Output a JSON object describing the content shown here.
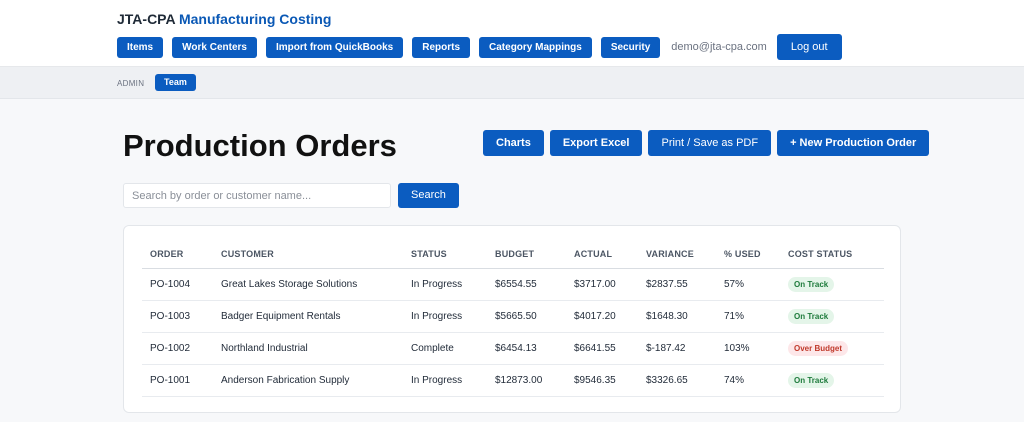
{
  "header": {
    "brand_prefix": "JTA-CPA",
    "brand_suffix": "Manufacturing Costing",
    "nav": [
      {
        "label": "Items"
      },
      {
        "label": "Work Centers"
      },
      {
        "label": "Import from QuickBooks"
      },
      {
        "label": "Reports"
      },
      {
        "label": "Category Mappings"
      },
      {
        "label": "Security"
      }
    ],
    "email": "demo@jta-cpa.com",
    "logout_label": "Log out"
  },
  "subnav": {
    "admin_label": "ADMIN",
    "team_label": "Team"
  },
  "main": {
    "title": "Production Orders",
    "actions": {
      "charts": "Charts",
      "export_excel": "Export Excel",
      "print_pdf": "Print / Save as PDF",
      "new_order": "+ New Production Order"
    },
    "search": {
      "placeholder": "Search by order or customer name...",
      "value": "",
      "button_label": "Search"
    },
    "table": {
      "headers": [
        "ORDER",
        "CUSTOMER",
        "STATUS",
        "BUDGET",
        "ACTUAL",
        "VARIANCE",
        "% USED",
        "COST STATUS"
      ],
      "rows": [
        {
          "order": "PO-1004",
          "customer": "Great Lakes Storage Solutions",
          "status": "In Progress",
          "budget": "$6554.55",
          "actual": "$3717.00",
          "variance": "$2837.55",
          "used": "57%",
          "cost_status": "On Track"
        },
        {
          "order": "PO-1003",
          "customer": "Badger Equipment Rentals",
          "status": "In Progress",
          "budget": "$5665.50",
          "actual": "$4017.20",
          "variance": "$1648.30",
          "used": "71%",
          "cost_status": "On Track"
        },
        {
          "order": "PO-1002",
          "customer": "Northland Industrial",
          "status": "Complete",
          "budget": "$6454.13",
          "actual": "$6641.55",
          "variance": "$-187.42",
          "used": "103%",
          "cost_status": "Over Budget"
        },
        {
          "order": "PO-1001",
          "customer": "Anderson Fabrication Supply",
          "status": "In Progress",
          "budget": "$12873.00",
          "actual": "$9546.35",
          "variance": "$3326.65",
          "used": "74%",
          "cost_status": "On Track"
        }
      ]
    }
  },
  "colors": {
    "primary": "#0b5cc0",
    "ok_bg": "#e4f5e9",
    "ok_text": "#1e7b3c",
    "over_bg": "#fde7e9",
    "over_text": "#c0392b"
  }
}
